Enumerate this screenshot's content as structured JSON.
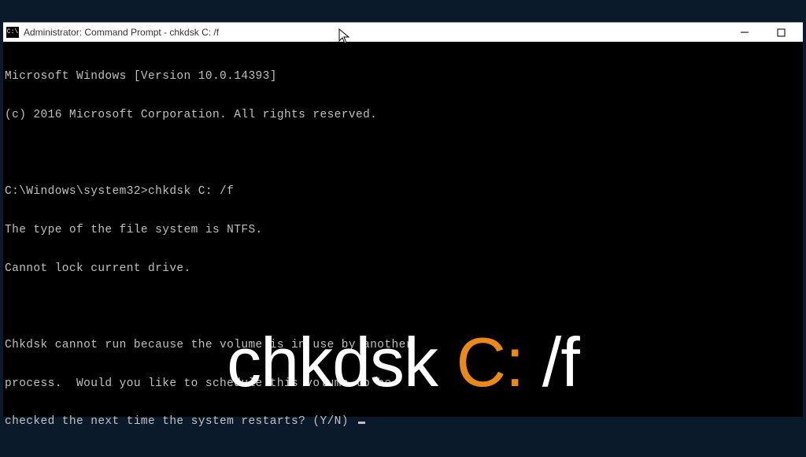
{
  "titlebar": {
    "icon_label": "C:\\",
    "title": "Administrator: Command Prompt - chkdsk  C: /f"
  },
  "terminal": {
    "lines": [
      "Microsoft Windows [Version 10.0.14393]",
      "(c) 2016 Microsoft Corporation. All rights reserved.",
      "",
      "C:\\Windows\\system32>chkdsk C: /f",
      "The type of the file system is NTFS.",
      "Cannot lock current drive.",
      "",
      "Chkdsk cannot run because the volume is in use by another",
      "process.  Would you like to schedule this volume to be",
      "checked the next time the system restarts? (Y/N) "
    ]
  },
  "overlay": {
    "part1": "chkdsk ",
    "part2": "C:",
    "part3": " /f"
  },
  "colors": {
    "terminal_fg": "#c0c0c0",
    "terminal_bg": "#000000",
    "accent": "#e8891a"
  }
}
